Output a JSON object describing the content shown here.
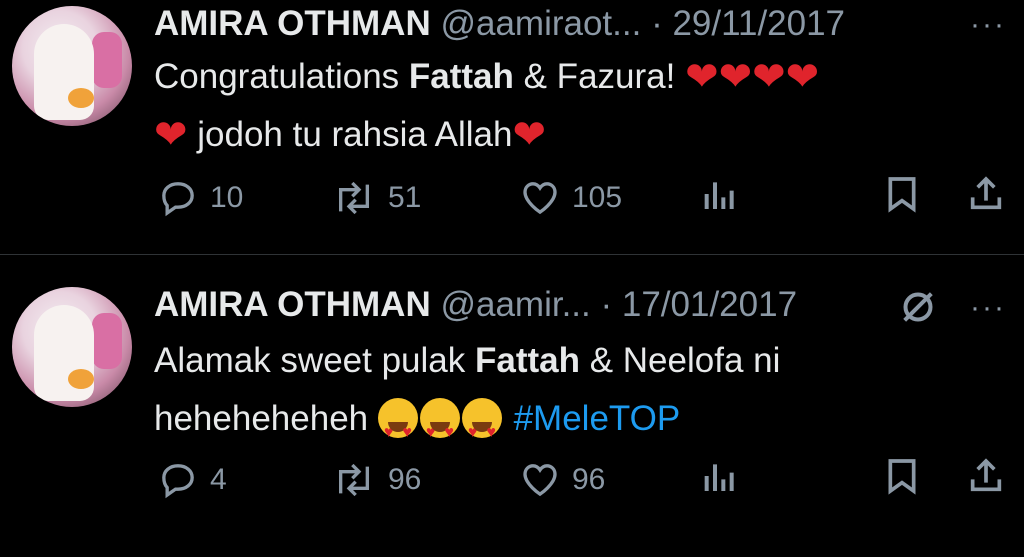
{
  "tweets": [
    {
      "name": "AMIRA OTHMAN",
      "handle": "@aamiraot...",
      "sep": "·",
      "date": "29/11/2017",
      "more": "···",
      "body": {
        "line1_pre": "Congratulations ",
        "line1_bold": "Fattah",
        "line1_post": " & Fazura!",
        "line2_text": "jodoh tu rahsia Allah"
      },
      "counts": {
        "reply": "10",
        "retweet": "51",
        "like": "105"
      }
    },
    {
      "name": "AMIRA OTHMAN",
      "handle": "@aamir...",
      "sep": "·",
      "date": "17/01/2017",
      "more": "···",
      "body": {
        "line1_pre": "Alamak sweet pulak ",
        "line1_bold": "Fattah",
        "line1_post": " & Neelofa ni",
        "line2_text": "heheheheheh",
        "hashtag": "#MeleTOP"
      },
      "counts": {
        "reply": "4",
        "retweet": "96",
        "like": "96"
      }
    }
  ],
  "icons": [
    "reply-icon",
    "retweet-icon",
    "like-icon",
    "views-icon",
    "bookmark-icon",
    "share-icon",
    "hidden-reply-icon",
    "red-heart-emoji",
    "heart-eyes-emoji"
  ],
  "colors": {
    "background": "#000000",
    "text": "#e7e9ea",
    "muted": "#8b98a5",
    "link": "#1d9bf0",
    "heart": "#e0242c"
  }
}
